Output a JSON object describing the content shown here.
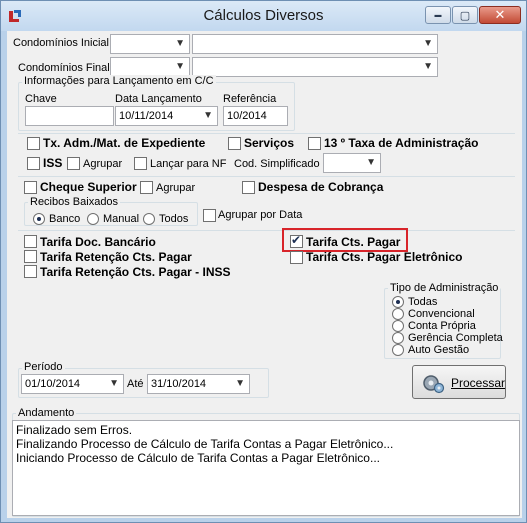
{
  "window": {
    "title": "Cálculos Diversos",
    "minimize_glyph": "▬",
    "maximize_glyph": "▢",
    "close_glyph": "✕"
  },
  "filters": {
    "condominios_inicial_label": "Condomínios Inicial",
    "condominios_final_label": "Condomínios Final",
    "condominios_inicial_code": "",
    "condominios_inicial_name": "",
    "condominios_final_code": "",
    "condominios_final_name": ""
  },
  "lancamento": {
    "group_title": "Informações para Lançamento em C/C",
    "chave_label": "Chave",
    "chave_value": "",
    "data_label": "Data Lançamento",
    "data_value": "10/11/2014",
    "referencia_label": "Referência",
    "referencia_value": "10/2014"
  },
  "options": {
    "tx_adm": {
      "label": "Tx. Adm./Mat. de Expediente",
      "checked": false
    },
    "servicos": {
      "label": "Serviços",
      "checked": false
    },
    "decimo_terceiro": {
      "label": "13 º Taxa de Administração",
      "checked": false
    },
    "iss": {
      "label": "ISS",
      "checked": false
    },
    "agrupar_iss": {
      "label": "Agrupar",
      "checked": false
    },
    "lancar_nf": {
      "label": "Lançar para NF",
      "checked": false
    },
    "cod_simplificado_label": "Cod. Simplificado",
    "cod_simplificado_value": "",
    "cheque_superior": {
      "label": "Cheque Superior",
      "checked": false
    },
    "agrupar_cheque": {
      "label": "Agrupar",
      "checked": false
    },
    "despesa_cobranca": {
      "label": "Despesa de Cobrança",
      "checked": false
    },
    "recibos_title": "Recibos Baixados",
    "recibos_options": [
      "Banco",
      "Manual",
      "Todos"
    ],
    "recibos_selected": "Banco",
    "agrupar_por_data": {
      "label": "Agrupar por Data",
      "checked": false
    },
    "tarifa_doc_bancario": {
      "label": "Tarifa Doc. Bancário",
      "checked": false
    },
    "tarifa_retencao": {
      "label": "Tarifa Retenção Cts. Pagar",
      "checked": false
    },
    "tarifa_retencao_inss": {
      "label": "Tarifa Retenção Cts. Pagar - INSS",
      "checked": false
    },
    "tarifa_cts_pagar": {
      "label": "Tarifa Cts. Pagar",
      "checked": true
    },
    "tarifa_cts_pagar_eletronico": {
      "label": "Tarifa Cts. Pagar Eletrônico",
      "checked": false
    }
  },
  "tipo_administracao": {
    "title": "Tipo de Administração",
    "options": [
      "Todas",
      "Convencional",
      "Conta Própria",
      "Gerência Completa",
      "Auto Gestão"
    ],
    "selected": "Todas"
  },
  "periodo": {
    "title": "Período",
    "inicio": "01/10/2014",
    "ate_label": "Até",
    "fim": "31/10/2014"
  },
  "processar_button": "Processar",
  "andamento": {
    "title": "Andamento",
    "lines": [
      "Finalizado sem Erros.",
      "Finalizando Processo de Cálculo de Tarifa Contas a Pagar Eletrônico...",
      "Iniciando Processo de Cálculo de Tarifa Contas a Pagar Eletrônico..."
    ]
  },
  "colors": {
    "highlight_border": "#d8242a",
    "title_bar": "#c2d8ef",
    "client_background": "#f0f0f0"
  }
}
